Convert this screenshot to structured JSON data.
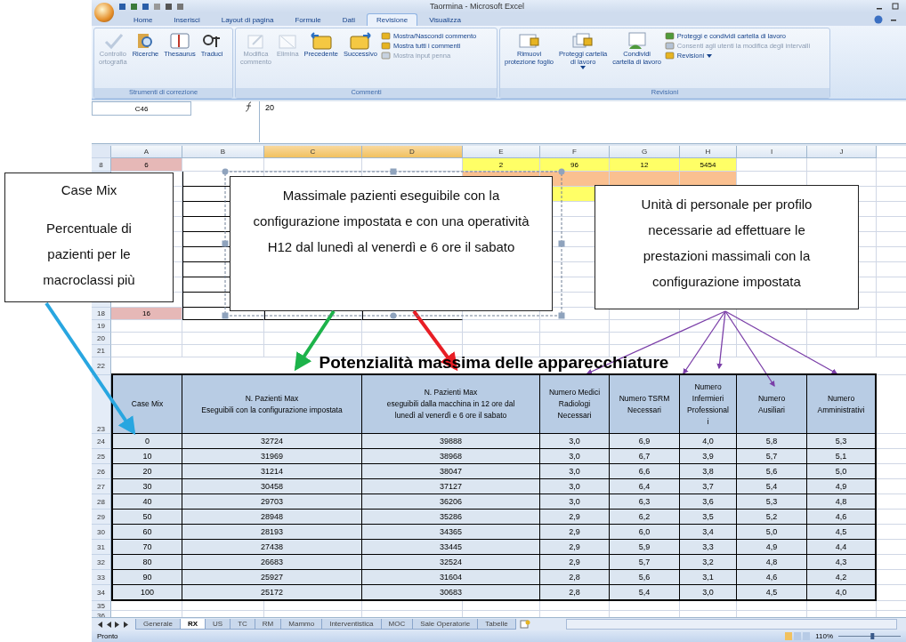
{
  "window": {
    "title": "Taormina - Microsoft Excel"
  },
  "ribbon_tabs": [
    {
      "label": "Home",
      "selected": false
    },
    {
      "label": "Inserisci",
      "selected": false
    },
    {
      "label": "Layout di pagina",
      "selected": false
    },
    {
      "label": "Formule",
      "selected": false
    },
    {
      "label": "Dati",
      "selected": false
    },
    {
      "label": "Revisione",
      "selected": true
    },
    {
      "label": "Visualizza",
      "selected": false
    }
  ],
  "ribbon_groups": [
    {
      "label": "Strumenti di correzione",
      "buttons": [
        {
          "kind": "large",
          "lines": [
            "Controllo",
            "ortografia"
          ],
          "disabled": true
        },
        {
          "kind": "large",
          "lines": [
            "Ricerche"
          ],
          "disabled": false
        },
        {
          "kind": "large",
          "lines": [
            "Thesaurus"
          ],
          "disabled": false
        },
        {
          "kind": "large",
          "lines": [
            "Traduci"
          ],
          "disabled": false
        }
      ]
    },
    {
      "label": "Commenti",
      "buttons": [
        {
          "kind": "large",
          "lines": [
            "Modifica",
            "commento"
          ],
          "disabled": true
        },
        {
          "kind": "large",
          "lines": [
            "Elimina"
          ],
          "disabled": true
        },
        {
          "kind": "large",
          "lines": [
            "Precedente"
          ],
          "disabled": false
        },
        {
          "kind": "large",
          "lines": [
            "Successivo"
          ],
          "disabled": false
        },
        {
          "kind": "small",
          "lines": [
            "Mostra/Nascondi commento"
          ],
          "disabled": false
        },
        {
          "kind": "small",
          "lines": [
            "Mostra tutti i commenti"
          ],
          "disabled": false
        },
        {
          "kind": "small",
          "lines": [
            "Mostra input penna"
          ],
          "disabled": true
        }
      ]
    },
    {
      "label": "Revisioni",
      "buttons": [
        {
          "kind": "large",
          "lines": [
            "Rimuovi",
            "protezione foglio"
          ],
          "disabled": false
        },
        {
          "kind": "large",
          "lines": [
            "Proteggi cartella",
            "di lavoro"
          ],
          "disabled": false,
          "dropdown": true
        },
        {
          "kind": "large",
          "lines": [
            "Condividi",
            "cartella di lavoro"
          ],
          "disabled": false
        },
        {
          "kind": "small",
          "lines": [
            "Proteggi e condividi cartella di lavoro"
          ],
          "disabled": false
        },
        {
          "kind": "small",
          "lines": [
            "Consenti agli utenti la modifica degli intervalli"
          ],
          "disabled": true
        },
        {
          "kind": "small",
          "lines": [
            "Revisioni"
          ],
          "disabled": false,
          "dropdown": true
        }
      ]
    }
  ],
  "name_box": "C46",
  "formula": "20",
  "sheet": {
    "columns": [
      {
        "label": "A",
        "selected": false
      },
      {
        "label": "B",
        "selected": false
      },
      {
        "label": "C",
        "selected": true
      },
      {
        "label": "D",
        "selected": true
      },
      {
        "label": "E",
        "selected": false
      },
      {
        "label": "F",
        "selected": false
      },
      {
        "label": "G",
        "selected": false
      },
      {
        "label": "H",
        "selected": false
      },
      {
        "label": "I",
        "selected": false
      },
      {
        "label": "J",
        "selected": false
      }
    ],
    "rows": [
      {
        "number": "8",
        "cells": [
          {
            "text": "6",
            "color": "#e6b8b7"
          },
          {},
          {},
          {},
          {
            "text": "2",
            "color": "#ffff66"
          },
          {
            "text": "96",
            "color": "#ffff66"
          },
          {
            "text": "12",
            "color": "#ffff66"
          },
          {
            "text": "5454",
            "color": "#ffff66"
          },
          {},
          {}
        ]
      },
      {
        "cells": [
          {},
          {
            "bordered": true
          },
          {},
          {},
          {
            "color": "#fac090"
          },
          {
            "color": "#fac090"
          },
          {
            "color": "#fac090"
          },
          {
            "color": "#fac090"
          },
          {},
          {}
        ]
      },
      {
        "cells": [
          {},
          {
            "bordered": true
          },
          {},
          {},
          {},
          {
            "color": "#ffff66"
          },
          {},
          {},
          {},
          {}
        ]
      },
      {
        "cells": [
          {},
          {
            "bordered": true
          },
          {},
          {},
          {},
          {},
          {},
          {},
          {},
          {}
        ]
      },
      {
        "cells": [
          {},
          {
            "bordered": true
          },
          {},
          {},
          {},
          {},
          {},
          {},
          {},
          {}
        ]
      },
      {
        "cells": [
          {},
          {
            "bordered": true
          },
          {},
          {},
          {},
          {},
          {},
          {},
          {},
          {}
        ]
      },
      {
        "cells": [
          {},
          {
            "bordered": true
          },
          {},
          {},
          {},
          {},
          {},
          {},
          {},
          {}
        ]
      },
      {
        "cells": [
          {},
          {
            "bordered": true
          },
          {},
          {},
          {},
          {},
          {},
          {},
          {},
          {}
        ]
      },
      {
        "cells": [
          {},
          {
            "bordered": true
          },
          {},
          {},
          {},
          {},
          {},
          {},
          {},
          {}
        ]
      },
      {
        "cells": [
          {},
          {
            "bordered": true
          },
          {},
          {},
          {},
          {},
          {},
          {},
          {},
          {}
        ]
      },
      {
        "number": "18",
        "cells": [
          {
            "text": "16",
            "color": "#e6b8b7"
          },
          {
            "bordered": true
          },
          {
            "bordered": true
          },
          {
            "bordered": true
          },
          {},
          {},
          {},
          {},
          {},
          {}
        ]
      },
      {
        "number": "19",
        "cells": [
          {},
          {},
          {},
          {},
          {},
          {},
          {},
          {},
          {},
          {}
        ]
      },
      {
        "number": "20",
        "cells": [
          {},
          {},
          {},
          {},
          {},
          {},
          {},
          {},
          {},
          {}
        ]
      },
      {
        "number": "21",
        "cells": [
          {},
          {},
          {},
          {},
          {},
          {},
          {},
          {},
          {},
          {}
        ]
      }
    ]
  },
  "table": {
    "title_row": "22",
    "title": "Potenzialità massima delle apparecchiature",
    "header_row": "23",
    "headers": [
      [
        "Case Mix"
      ],
      [
        "N. Pazienti Max",
        "Eseguibili con la configurazione impostata"
      ],
      [
        "N. Pazienti  Max",
        "eseguibili dalla macchina in 12 ore dal",
        "lunedì al venerdì e 6 ore il sabato"
      ],
      [
        "Numero Medici",
        "Radiologi",
        "Necessari"
      ],
      [
        "Numero TSRM",
        "Necessari"
      ],
      [
        "Numero",
        "Infermieri",
        "Professional",
        "i"
      ],
      [
        "Numero",
        "Ausiliari"
      ],
      [
        "Numero",
        "Amministrativi"
      ]
    ],
    "rows": [
      {
        "number": "24",
        "cells": [
          "0",
          "32724",
          "39888",
          "3,0",
          "6,9",
          "4,0",
          "5,8",
          "5,3"
        ]
      },
      {
        "number": "25",
        "cells": [
          "10",
          "31969",
          "38968",
          "3,0",
          "6,7",
          "3,9",
          "5,7",
          "5,1"
        ]
      },
      {
        "number": "26",
        "cells": [
          "20",
          "31214",
          "38047",
          "3,0",
          "6,6",
          "3,8",
          "5,6",
          "5,0"
        ]
      },
      {
        "number": "27",
        "cells": [
          "30",
          "30458",
          "37127",
          "3,0",
          "6,4",
          "3,7",
          "5,4",
          "4,9"
        ]
      },
      {
        "number": "28",
        "cells": [
          "40",
          "29703",
          "36206",
          "3,0",
          "6,3",
          "3,6",
          "5,3",
          "4,8"
        ]
      },
      {
        "number": "29",
        "cells": [
          "50",
          "28948",
          "35286",
          "2,9",
          "6,2",
          "3,5",
          "5,2",
          "4,6"
        ]
      },
      {
        "number": "30",
        "cells": [
          "60",
          "28193",
          "34365",
          "2,9",
          "6,0",
          "3,4",
          "5,0",
          "4,5"
        ]
      },
      {
        "number": "31",
        "cells": [
          "70",
          "27438",
          "33445",
          "2,9",
          "5,9",
          "3,3",
          "4,9",
          "4,4"
        ]
      },
      {
        "number": "32",
        "cells": [
          "80",
          "26683",
          "32524",
          "2,9",
          "5,7",
          "3,2",
          "4,8",
          "4,3"
        ]
      },
      {
        "number": "33",
        "cells": [
          "90",
          "25927",
          "31604",
          "2,8",
          "5,6",
          "3,1",
          "4,6",
          "4,2"
        ]
      },
      {
        "number": "34",
        "cells": [
          "100",
          "25172",
          "30683",
          "2,8",
          "5,4",
          "3,0",
          "4,5",
          "4,0"
        ]
      }
    ],
    "trailing_rows": [
      "35",
      "36"
    ]
  },
  "sheet_tabs": [
    {
      "label": "Generale",
      "selected": false
    },
    {
      "label": "RX",
      "selected": true
    },
    {
      "label": "US",
      "selected": false
    },
    {
      "label": "TC",
      "selected": false
    },
    {
      "label": "RM",
      "selected": false
    },
    {
      "label": "Mammo",
      "selected": false
    },
    {
      "label": "Interventistica",
      "selected": false
    },
    {
      "label": "MOC",
      "selected": false
    },
    {
      "label": "Sale Operatorie",
      "selected": false
    },
    {
      "label": "Tabelle",
      "selected": false
    }
  ],
  "status_bar": {
    "text": "Pronto",
    "zoom": "110%",
    "zoom_slider": {
      "level": 0.55
    }
  },
  "callouts": [
    {
      "title": "Case Mix",
      "text": "Percentuale di pazienti per le macroclassi più"
    },
    {
      "text": "Massimale pazienti eseguibile con la configurazione impostata  e con una operatività H12 dal lunedì al venerdì e 6 ore il sabato"
    },
    {
      "text": "Unità di personale per profilo necessarie ad effettuare le prestazioni massimali con la configurazione impostata"
    }
  ]
}
